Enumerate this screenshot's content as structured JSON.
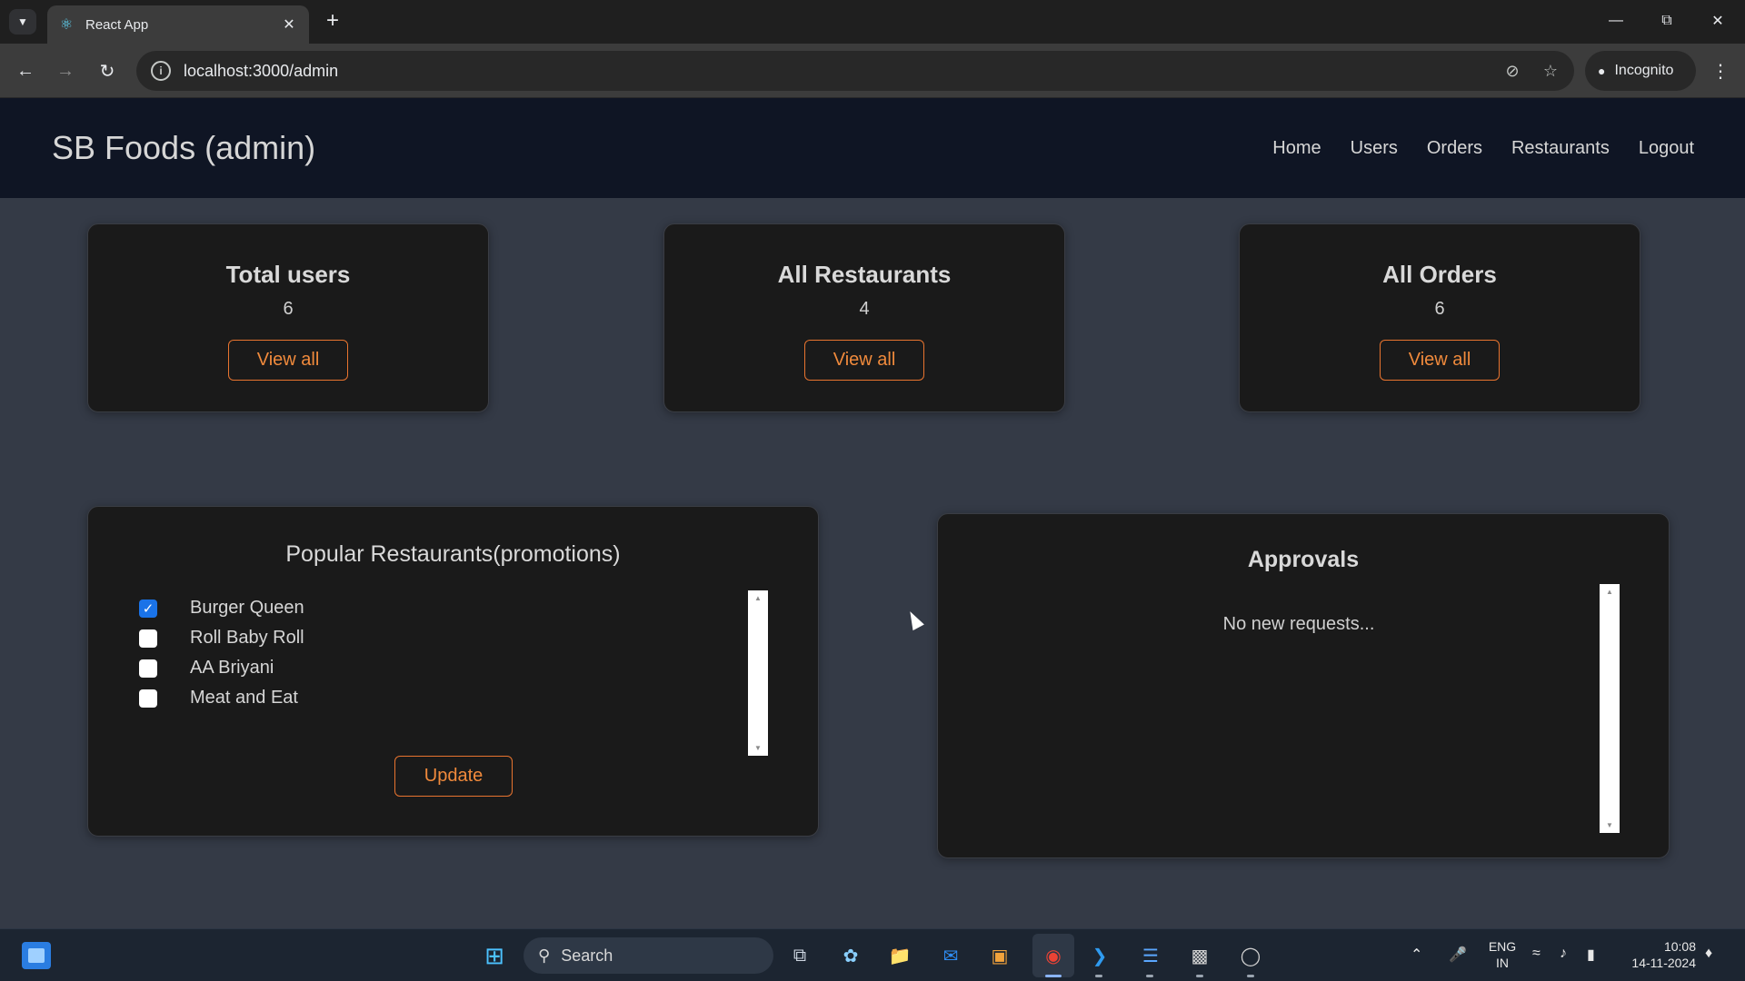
{
  "browser": {
    "tab_title": "React App",
    "url": "localhost:3000/admin",
    "incognito_label": "Incognito"
  },
  "app": {
    "brand": "SB Foods (admin)",
    "nav": [
      "Home",
      "Users",
      "Orders",
      "Restaurants",
      "Logout"
    ]
  },
  "stats": [
    {
      "title": "Total users",
      "count": "6",
      "button": "View all"
    },
    {
      "title": "All Restaurants",
      "count": "4",
      "button": "View all"
    },
    {
      "title": "All Orders",
      "count": "6",
      "button": "View all"
    }
  ],
  "promotions": {
    "title": "Popular Restaurants(promotions)",
    "items": [
      {
        "label": "Burger Queen",
        "checked": true
      },
      {
        "label": "Roll Baby Roll",
        "checked": false
      },
      {
        "label": "AA Briyani",
        "checked": false
      },
      {
        "label": "Meat and Eat",
        "checked": false
      }
    ],
    "update_button": "Update"
  },
  "approvals": {
    "title": "Approvals",
    "empty_text": "No new requests..."
  },
  "taskbar": {
    "search_label": "Search",
    "lang_line1": "ENG",
    "lang_line2": "IN",
    "time": "10:08",
    "date": "14-11-2024"
  },
  "colors": {
    "accent_orange": "#e8742f",
    "navbar_bg": "#0f1524",
    "page_bg": "#343a46",
    "card_bg": "#1a1a1a",
    "checkbox_checked": "#1a73e8"
  }
}
